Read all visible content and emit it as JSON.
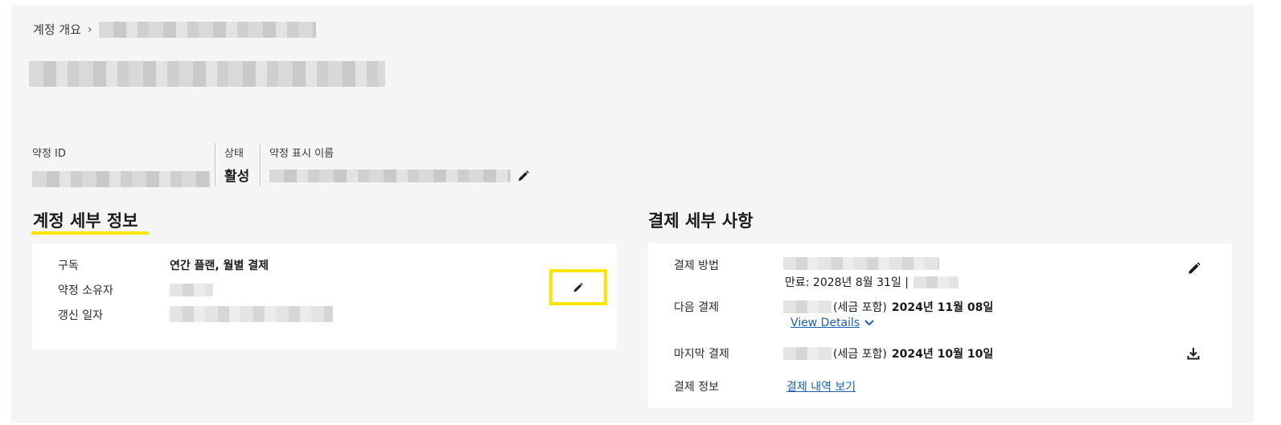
{
  "breadcrumb": {
    "root": "계정 개요",
    "separator": "›"
  },
  "summary": {
    "agreement_id_label": "약정 ID",
    "status_label": "상태",
    "status_value": "활성",
    "display_name_label": "약정 표시 이름"
  },
  "account_details": {
    "title": "계정 세부 정보",
    "rows": [
      {
        "label": "구독",
        "value": "연간 플랜, 월별 결제"
      },
      {
        "label": "약정 소유자",
        "value": ""
      },
      {
        "label": "갱신 일자",
        "value": ""
      }
    ]
  },
  "billing_details": {
    "title": "결제 세부 사항",
    "payment_method_label": "결제 방법",
    "expiry_text": "만료: 2028년 8월 31일 |",
    "next_payment_label": "다음 결제",
    "next_payment_tax": "(세금 포함)",
    "next_payment_date": "2024년 11월 08일",
    "view_details_link": "View Details",
    "last_payment_label": "마지막 결제",
    "last_payment_tax": "(세금 포함)",
    "last_payment_date": "2024년 10월 10일",
    "billing_info_label": "결제 정보",
    "billing_history_link": "결제 내역 보기"
  },
  "colors": {
    "highlight": "#ffe600",
    "link": "#1b5fb0",
    "background": "#f5f5f5"
  },
  "icons": [
    "pencil-icon",
    "download-icon",
    "chevron-down-icon"
  ]
}
